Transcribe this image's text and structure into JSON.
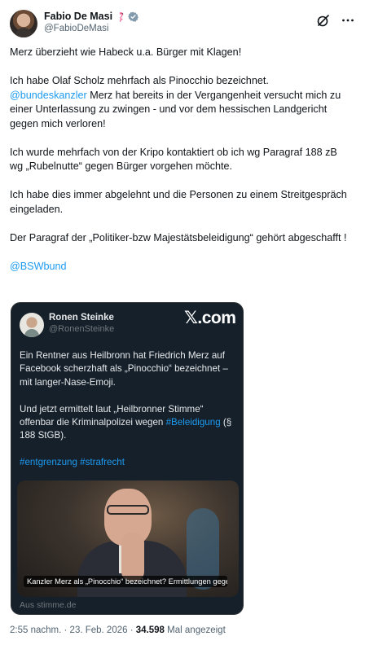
{
  "post": {
    "author_name": "Fabio De Masi",
    "author_handle": "@FabioDeMasi",
    "paragraphs": [
      {
        "text": "Merz überzieht wie Habeck u.a. Bürger mit Klagen!"
      },
      {
        "text": "Ich habe Olaf Scholz mehrfach als Pinocchio bezeichnet.",
        "mention": "@bundeskanzler",
        "after_mention": " Merz hat bereits in der Vergangenheit versucht mich zu einer Unterlassung zu zwingen - und vor dem hessischen Landgericht gegen mich verloren!"
      },
      {
        "text": "Ich wurde mehrfach von der Kripo kontaktiert ob ich wg Paragraf 188 zB wg „Rubelnutte“ gegen Bürger vorgehen möchte."
      },
      {
        "text": "Ich habe dies immer abgelehnt und die Personen zu einem Streitgespräch eingeladen."
      },
      {
        "text": "Der Paragraf der „Politiker-bzw Majestätsbeleidigung“ gehört abgeschafft !"
      }
    ],
    "final_mention": "@BSWbund"
  },
  "quoted_card": {
    "author_name": "Ronen Steinke",
    "author_handle": "@RonenSteinke",
    "site_badge": "𝕏.com",
    "para1": "Ein Rentner aus Heilbronn hat Friedrich Merz auf Facebook scherzhaft als „Pinocchio“ bezeichnet – mit langer-Nase-Emoji.",
    "para2_before": "Und jetzt ermittelt laut „Heilbronner Stimme“ offenbar die Kriminalpolizei wegen ",
    "para2_link": "#Beleidigung",
    "para2_after": " (§ 188 StGB).",
    "hashtag1": "#entgrenzung",
    "hashtag2": "#strafrecht",
    "image_caption": "Kanzler Merz als „Pinocchio“ bezeichnet? Ermittlungen gegen Heil...",
    "source": "Aus stimme.de"
  },
  "meta": {
    "time": "2:55 nachm.",
    "separator": "·",
    "date": "23. Feb. 2026",
    "views_count": "34.598",
    "views_label": "Mal angezeigt"
  },
  "icons": {
    "author_emoji": "flamingo-icon",
    "verified": "verified-badge-icon",
    "grok": "grok-icon",
    "more": "more-icon"
  },
  "colors": {
    "link": "#1d9bf0",
    "card_bg": "#15202b",
    "secondary_text": "#536471"
  }
}
